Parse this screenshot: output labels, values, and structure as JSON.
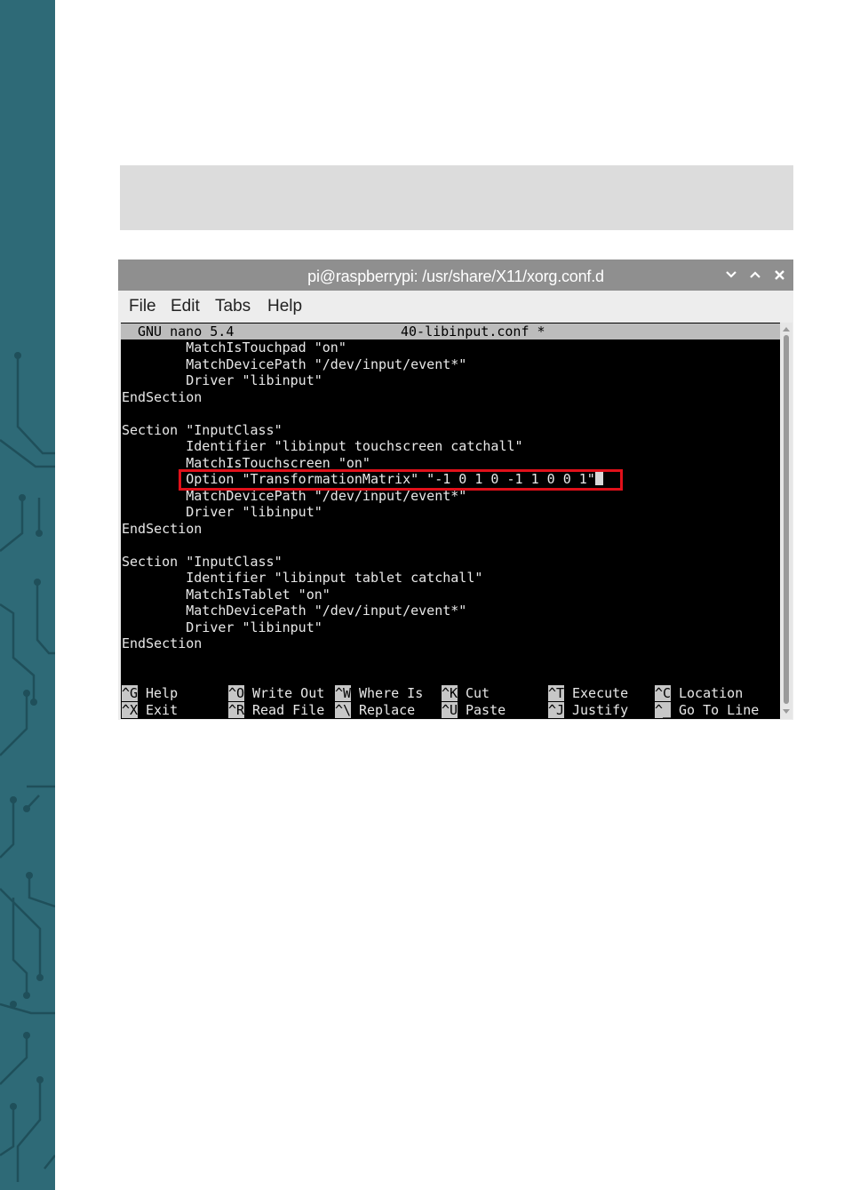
{
  "window": {
    "title": "pi@raspberrypi: /usr/share/X11/xorg.conf.d"
  },
  "menu": {
    "items": [
      "File",
      "Edit",
      "Tabs",
      "Help"
    ]
  },
  "nano": {
    "version": "GNU nano 5.4",
    "filename": "40-libinput.conf *"
  },
  "file_lines": [
    "        MatchIsTouchpad \"on\"",
    "        MatchDevicePath \"/dev/input/event*\"",
    "        Driver \"libinput\"",
    "EndSection",
    "",
    "Section \"InputClass\"",
    "        Identifier \"libinput touchscreen catchall\"",
    "        MatchIsTouchscreen \"on\"",
    "        Option \"TransformationMatrix\" \"-1 0 1 0 -1 1 0 0 1\"",
    "        MatchDevicePath \"/dev/input/event*\"",
    "        Driver \"libinput\"",
    "EndSection",
    "",
    "Section \"InputClass\"",
    "        Identifier \"libinput tablet catchall\"",
    "        MatchIsTablet \"on\"",
    "        MatchDevicePath \"/dev/input/event*\"",
    "        Driver \"libinput\"",
    "EndSection"
  ],
  "shortcuts": {
    "row1": [
      {
        "key": "^G",
        "label": "Help"
      },
      {
        "key": "^O",
        "label": "Write Out"
      },
      {
        "key": "^W",
        "label": "Where Is"
      },
      {
        "key": "^K",
        "label": "Cut"
      },
      {
        "key": "^T",
        "label": "Execute"
      },
      {
        "key": "^C",
        "label": "Location"
      }
    ],
    "row2": [
      {
        "key": "^X",
        "label": "Exit"
      },
      {
        "key": "^R",
        "label": "Read File"
      },
      {
        "key": "^\\",
        "label": "Replace"
      },
      {
        "key": "^U",
        "label": "Paste"
      },
      {
        "key": "^J",
        "label": "Justify"
      },
      {
        "key": "^_",
        "label": "Go To Line"
      }
    ]
  },
  "colors": {
    "sidebar": "#2e6a77",
    "highlight": "#e0101a",
    "terminal_bg": "#000000",
    "titlebar": "#8f8f8f"
  },
  "icons": {
    "minimize": "chevron-down-icon",
    "maximize": "chevron-up-icon",
    "close": "close-icon"
  }
}
